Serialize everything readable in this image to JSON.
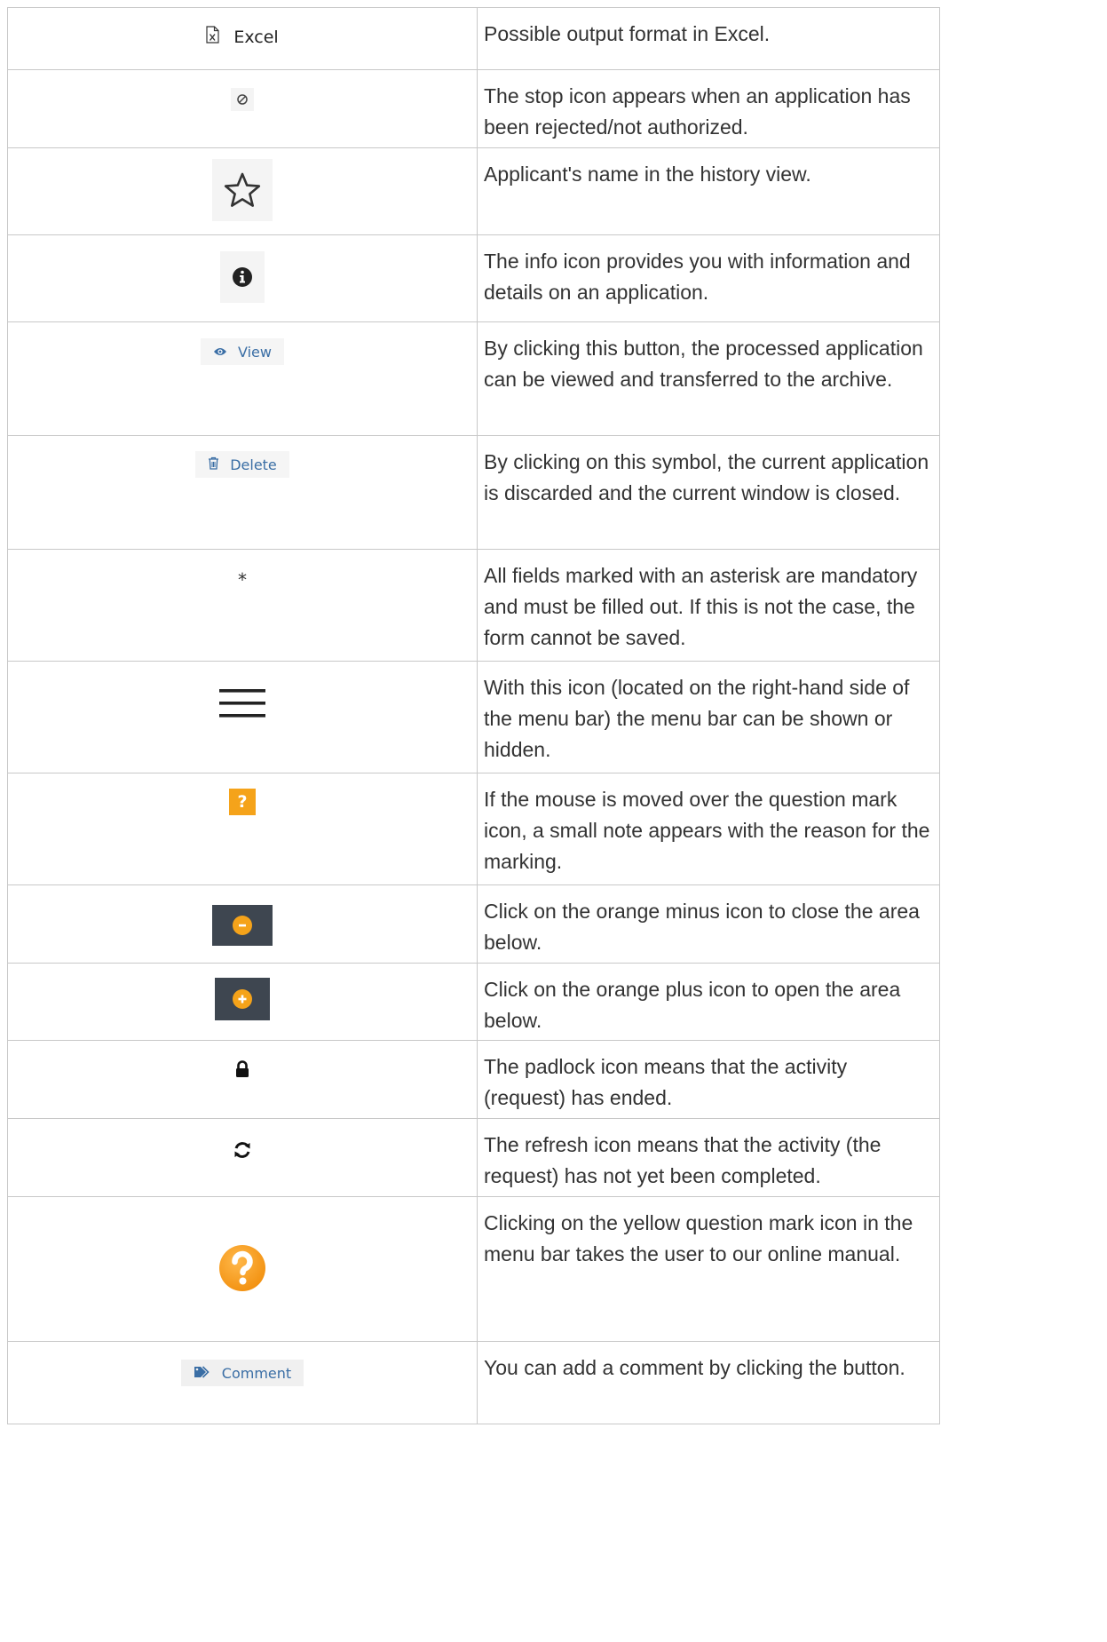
{
  "colors": {
    "accent_orange": "#f5a31a",
    "link_blue": "#3a6ea5",
    "dark_bg": "#3e4650",
    "border": "#c8c8c8",
    "text": "#333333"
  },
  "rows": [
    {
      "icon": "excel-file-icon",
      "label": "Excel",
      "description": "Possible output format in Excel."
    },
    {
      "icon": "stop-icon",
      "description": "The stop icon appears when an application has been rejected/not authorized."
    },
    {
      "icon": "star-icon",
      "description": "Applicant's name in the history view."
    },
    {
      "icon": "info-icon",
      "description": "The info icon provides you with information and details on an application."
    },
    {
      "icon": "eye-icon",
      "label": "View",
      "description": "By clicking this button, the processed application can be viewed and transferred to the archive."
    },
    {
      "icon": "trash-icon",
      "label": "Delete",
      "description": "By clicking on this symbol, the current application is discarded and the current window is closed."
    },
    {
      "icon": "asterisk-icon",
      "symbol": "*",
      "description": "All fields marked with an asterisk are mandatory and must be filled out. If this is not the case, the form cannot be saved."
    },
    {
      "icon": "hamburger-menu-icon",
      "description": "With this icon (located on the right-hand side of the menu bar) the menu bar can be shown or hidden."
    },
    {
      "icon": "question-mark-square-icon",
      "symbol": "?",
      "description": "If the mouse is moved over the question mark icon, a small note appears with the reason for the marking."
    },
    {
      "icon": "orange-minus-icon",
      "description": "Click on the orange minus icon to close the area below."
    },
    {
      "icon": "orange-plus-icon",
      "description": "Click on the orange plus icon to open the area below."
    },
    {
      "icon": "padlock-icon",
      "description": "The padlock icon means that the activity (request) has ended."
    },
    {
      "icon": "refresh-icon",
      "description": "The refresh icon means that the activity (the request) has not yet been completed."
    },
    {
      "icon": "yellow-question-mark-circle-icon",
      "description": "Clicking on the yellow question mark icon in the menu bar takes the user to our online manual."
    },
    {
      "icon": "tag-icon",
      "label": "Comment",
      "description": "You can add a comment by clicking the button."
    }
  ]
}
